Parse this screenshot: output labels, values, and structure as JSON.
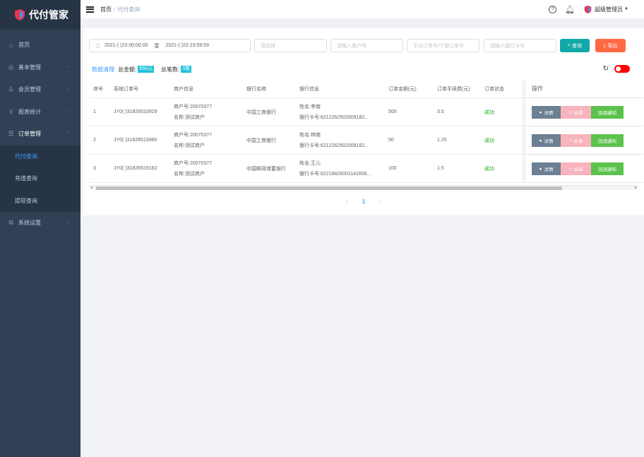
{
  "app": {
    "name": "代付管家"
  },
  "sidebar": {
    "items": [
      {
        "label": "首页",
        "icon": "home-icon"
      },
      {
        "label": "基本管理",
        "icon": "settings-icon"
      },
      {
        "label": "会员管理",
        "icon": "user-group-icon"
      },
      {
        "label": "报表统计",
        "icon": "bar-chart-icon"
      },
      {
        "label": "订单管理",
        "icon": "list-icon"
      }
    ],
    "sub_items": [
      "代付查询",
      "充值查询",
      "提现查询"
    ],
    "bottom_item": {
      "label": "系统设置",
      "icon": "gear-icon"
    }
  },
  "header": {
    "breadcrumb_home": "首页",
    "breadcrumb_sep": "/",
    "breadcrumb_current": "代付查询",
    "user_name": "超级管理员"
  },
  "filters": {
    "date_start": "2021-( )23 00:00:00",
    "date_sep": "至",
    "date_end": "2021-( )23 23:59:59",
    "select_placeholder": "请选择",
    "merchant_placeholder": "请输入商户号",
    "order_placeholder": "平台订单号/下游订单号",
    "card_placeholder": "请输入银行卡号",
    "query_label": "查询",
    "export_label": "导出"
  },
  "summary": {
    "clean_label": "数据清理",
    "total_amount_label": "总金额:",
    "total_amount_value": "650元",
    "total_count_label": "总笔数:",
    "total_count_value": "3笔"
  },
  "table": {
    "columns": [
      "序号",
      "系统订单号",
      "商户信息",
      "银行名称",
      "银行信息",
      "订单金额(元)",
      "订单手续费(元)",
      "订单状态",
      "操作"
    ],
    "rows": [
      {
        "index": "1",
        "order_no": "JY0( )31826510929",
        "merchant_no": "商户号:20070377",
        "merchant_name": "名称:测试商户",
        "bank": "中国工商银行",
        "holder": "姓名:李南",
        "card": "银行卡号:6212262502009182...",
        "amount": "500",
        "fee": "3.5",
        "status": "成功"
      },
      {
        "index": "2",
        "order_no": "JY0( )31826513960",
        "merchant_no": "商户号:20070377",
        "merchant_name": "名称:测试商户",
        "bank": "中国工商银行",
        "holder": "姓名:林南",
        "card": "银行卡号:6212262502009182...",
        "amount": "50",
        "fee": "1.25",
        "status": "成功"
      },
      {
        "index": "3",
        "order_no": "JY0( )31826519182",
        "merchant_no": "商户号:20070377",
        "merchant_name": "名称:测试商户",
        "bank": "中国邮政储蓄银行",
        "holder": "姓名:王儿",
        "card": "银行卡号:62218826001141666...",
        "amount": "100",
        "fee": "1.5",
        "status": "成功"
      }
    ],
    "actions": {
      "detail": "详情",
      "supplement": "补单",
      "notify": "回调通知"
    }
  },
  "pagination": {
    "prev": "‹",
    "current": "1",
    "next": "›"
  },
  "colors": {
    "sidebar": "#304156",
    "accent": "#409eff",
    "query": "#13a8a8",
    "export": "#ff6a45",
    "success": "#13a813"
  }
}
